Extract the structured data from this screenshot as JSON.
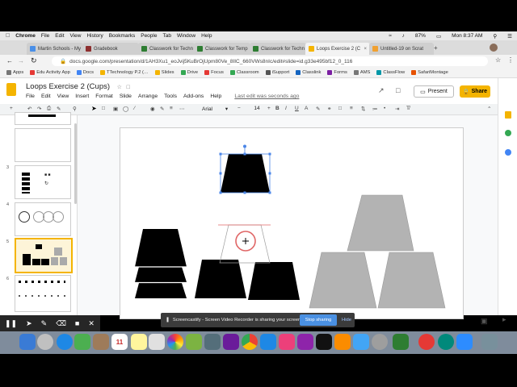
{
  "menubar": {
    "apple": "",
    "items": [
      "Chrome",
      "File",
      "Edit",
      "View",
      "History",
      "Bookmarks",
      "People",
      "Tab",
      "Window",
      "Help"
    ],
    "battery": "87%",
    "clock": "Mon 8:37 AM"
  },
  "tabs": [
    {
      "label": "Martin Schools - My",
      "color": "#4a8fe7"
    },
    {
      "label": "Gradebook",
      "color": "#8d2e2e"
    },
    {
      "label": "Classwork for Techn",
      "color": "#2e7d32"
    },
    {
      "label": "Classwork for Temp",
      "color": "#2e7d32"
    },
    {
      "label": "Classwork for Techn",
      "color": "#2e7d32"
    },
    {
      "label": "Loops Exercise 2 (C",
      "color": "#f4b400"
    },
    {
      "label": "Untitled-19 on Scrat",
      "color": "#f0a030"
    }
  ],
  "address": {
    "url": "docs.google.com/presentation/d/1AH3Xu1_eoJvij5KuBrOjUpm80Ve_8IIC_660VWs8nIc/edit#slide=id.g33e495bf12_0_116"
  },
  "bookmarks": [
    {
      "label": "Apps",
      "color": "#777"
    },
    {
      "label": "Edu Activity App",
      "color": "#e53935"
    },
    {
      "label": "Docs",
      "color": "#4285f4"
    },
    {
      "label": "TTechnology P.2 (…",
      "color": "#f4b400"
    },
    {
      "label": "Slides",
      "color": "#f4b400"
    },
    {
      "label": "Drive",
      "color": "#34a853"
    },
    {
      "label": "Focus",
      "color": "#e53935"
    },
    {
      "label": "Classroom",
      "color": "#34a853"
    },
    {
      "label": "iSupport",
      "color": "#555"
    },
    {
      "label": "Classlink",
      "color": "#1565c0"
    },
    {
      "label": "Forms",
      "color": "#7b1fa2"
    },
    {
      "label": "AMS",
      "color": "#777"
    },
    {
      "label": "ClassFlow",
      "color": "#0097a7"
    },
    {
      "label": "SafariMontage",
      "color": "#e65100"
    }
  ],
  "app": {
    "title": "Loops Exercise 2 (Cups)",
    "menu": [
      "File",
      "Edit",
      "View",
      "Insert",
      "Format",
      "Slide",
      "Arrange",
      "Tools",
      "Add-ons",
      "Help"
    ],
    "last_edit": "Last edit was seconds ago",
    "present_label": "Present",
    "share_label": "Share"
  },
  "toolbar": {
    "font": "Arial",
    "font_size": "14",
    "bold": "B",
    "italic": "I",
    "underline": "U",
    "text_color": "A"
  },
  "slides": [
    {
      "number": ""
    },
    {
      "number": ""
    },
    {
      "number": "3"
    },
    {
      "number": "4"
    },
    {
      "number": "5"
    },
    {
      "number": "6"
    }
  ],
  "castbar": {
    "message": "Screencastify - Screen Video Recorder is sharing your screen.",
    "stop_label": "Stop sharing",
    "hide_label": "Hide"
  },
  "dock": {
    "calendar_day": "11"
  },
  "colors": {
    "accent": "#f4b400",
    "cup_black": "#000000",
    "cup_gray": "#b3b3b3",
    "selection": "#4a86e8"
  }
}
